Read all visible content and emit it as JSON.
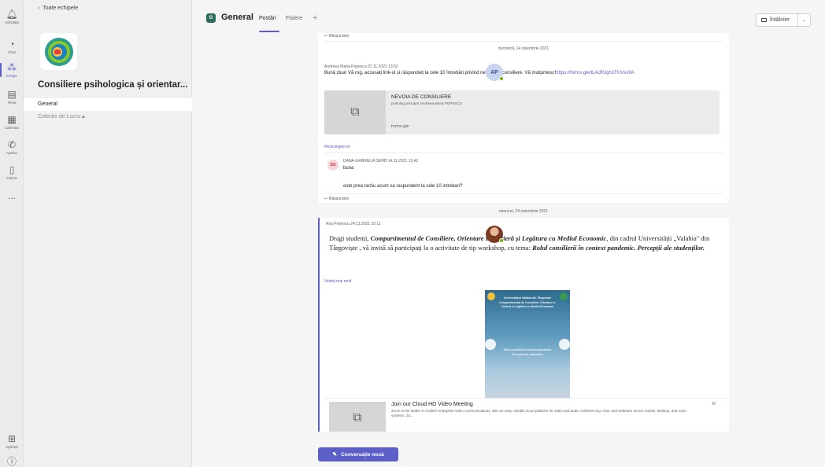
{
  "rail": {
    "items": [
      {
        "label": "Activitate",
        "icon": "bell-icon",
        "glyph": "🔔︎"
      },
      {
        "label": "Chat",
        "icon": "chat-icon",
        "glyph": "◔"
      },
      {
        "label": "Echipe",
        "icon": "teams-icon",
        "glyph": "⁂"
      },
      {
        "label": "Teme",
        "icon": "assignments-icon",
        "glyph": "▤"
      },
      {
        "label": "Calendar",
        "icon": "calendar-icon",
        "glyph": "▦"
      },
      {
        "label": "Apeluri",
        "icon": "phone-icon",
        "glyph": "✆"
      },
      {
        "label": "Fișiere",
        "icon": "file-icon",
        "glyph": "▯"
      },
      {
        "label": "...",
        "icon": "more-icon",
        "glyph": ""
      }
    ],
    "apps_label": "Aplicații",
    "help_label": ""
  },
  "team_panel": {
    "back_label": "Toate echipele",
    "team_name": "Consiliere psihologica și orientar...",
    "more": "···",
    "channels": [
      {
        "label": "General"
      },
      {
        "label": "Colectiv de Lucru 🔒︎"
      }
    ]
  },
  "topbar": {
    "channel_initials": "G",
    "channel_title": "General",
    "tabs": [
      "Postări",
      "Fișiere"
    ],
    "add_tab": "+",
    "meet_label": "Întâlnire",
    "meet_dropdown": "⌄"
  },
  "thread": {
    "reply_top": "↩ Răspundeți",
    "date_sep_1": "duminică, 14 noiembrie 2021",
    "post1": {
      "initials": "AP",
      "author_time": "Andreea Maria Popescu   07.11.2021 13:52",
      "text_part1": "Bună ziua! Vă rog, accesați link-ul și răspundeți la cele 10 întrebări privind nevoia de consiliere. Vă mulțumesc!",
      "link": "https://forms.gle/tLAdRJgh1FUVsx9A",
      "card_title": "NEVOIA DE CONSILIERE",
      "card_subtitle": "psiholog principal, Andreea Maria POPESCU",
      "card_domain": "forms.gle",
      "collapse_label": "Restrângeți tot",
      "reply_initials": "DS",
      "reply_author_time": "DANA-GABRIELA SERB   14.11.2021 13:42",
      "reply_text_1": "buna",
      "reply_text_2": "este prea tarziu acum sa raspundem la cele 10 intrebari?",
      "reply_link": "↩ Răspundeți"
    },
    "date_sep_2": "miercuri, 24 noiembrie 2021",
    "post2": {
      "author_time": "Ana Petrescu   24.11.2021 10:11",
      "text_intro": "Dragi studenți, ",
      "text_bold1": "Compartimentul de Consiliere, Orientare în Carieră și Legătura cu Mediul Economic",
      "text_mid": ", din cadrul Universității „Valahia\" din Târgoviște , vă invită să participați la o activitate de tip workshop, cu tema: ",
      "text_bold2": "Rolul consilierii în context pandemic. Percepții ale studenților.",
      "see_more": "Vedeți mai mult",
      "poster_lines": [
        "Universitatea Valahia din Târgoviște",
        "Compartimentul de Consiliere, Orientare în",
        "Carieră și Legătura cu Mediul Economic",
        "",
        "Rolul consilierii în context pandemic",
        "Percepții ale studenților"
      ],
      "link_title": "Join our Cloud HD Video Meeting",
      "link_desc": "Zoom is the leader in modern enterprise video communications, with an easy, reliable cloud platform for video and audio conferencing, chat, and webinars across mobile, desktop, and room systems. Zo...",
      "link_close": "✕"
    }
  },
  "new_conversation_label": "Conversație nouă",
  "colors": {
    "accent": "#5b5fc7",
    "presence": "#6bb700"
  }
}
